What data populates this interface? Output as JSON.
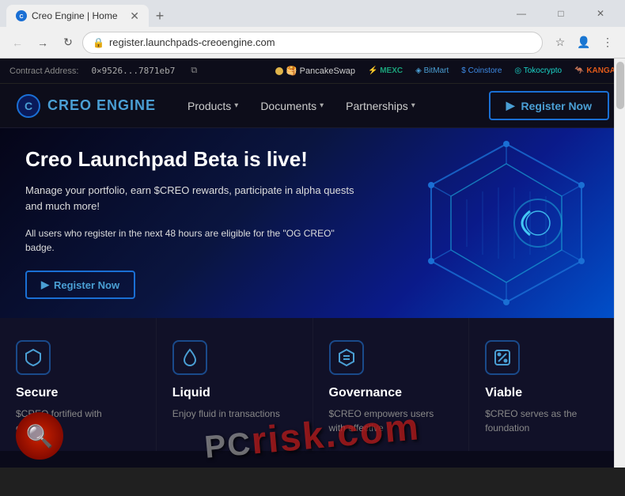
{
  "browser": {
    "tab": {
      "title": "Creo Engine | Home",
      "favicon": "C"
    },
    "address": "register.launchpads-creoengine.com",
    "window_controls": {
      "minimize": "—",
      "maximize": "□",
      "close": "✕"
    }
  },
  "bookmarks": [
    {
      "id": "pancakeswap",
      "label": "PancakeSwap",
      "color": "#e0b44a"
    },
    {
      "id": "mexc",
      "label": "MEXC",
      "color": "#1ba27a"
    },
    {
      "id": "bitmart",
      "label": "BitMart",
      "color": "#1a6fd4"
    },
    {
      "id": "coinstore",
      "label": "Coinstore",
      "color": "#3e8be6"
    },
    {
      "id": "tokocrypto",
      "label": "Tokocrypto",
      "color": "#1ad4c8"
    },
    {
      "id": "kanga",
      "label": "KANGA",
      "color": "#e05a1a"
    }
  ],
  "topbar": {
    "contract_label": "Contract Address:",
    "contract_address": "0×9526...7871eb7",
    "partners": [
      {
        "id": "pancakeswap",
        "label": "PancakeSwap",
        "color": "#e0b44a"
      },
      {
        "id": "mexc",
        "label": "MEXC",
        "color": "#1ba27a"
      },
      {
        "id": "bitmart",
        "label": "BitMart",
        "color": "#1a6fd4"
      },
      {
        "id": "coinstore",
        "label": "Coinstore",
        "color": "#3e8be6"
      },
      {
        "id": "tokocrypto",
        "label": "Tokocrypto",
        "color": "#1ad4c8"
      },
      {
        "id": "kanga",
        "label": "KANGA",
        "color": "#e05a1a"
      }
    ]
  },
  "navbar": {
    "logo_text": "CREO ENGINE",
    "nav_items": [
      {
        "id": "products",
        "label": "Products",
        "has_dropdown": true
      },
      {
        "id": "documents",
        "label": "Documents",
        "has_dropdown": true
      },
      {
        "id": "partnerships",
        "label": "Partnerships",
        "has_dropdown": true
      }
    ],
    "register_btn": "Register Now"
  },
  "hero": {
    "title": "Creo Launchpad Beta is live!",
    "subtitle": "Manage your portfolio, earn $CREO rewards, participate in alpha quests and much more!",
    "badge_text": "All users who register in the next 48 hours are eligible for the \"OG CREO\" badge.",
    "register_btn": "Register Now"
  },
  "features": [
    {
      "id": "secure",
      "icon": "shield",
      "title": "Secure",
      "desc": "$CREO fortified with certificates"
    },
    {
      "id": "liquid",
      "icon": "droplet",
      "title": "Liquid",
      "desc": "Enjoy fluid in transactions"
    },
    {
      "id": "governance",
      "icon": "hexagon",
      "title": "Governance",
      "desc": "$CREO empowers users with effective"
    },
    {
      "id": "viable",
      "icon": "percent",
      "title": "Viable",
      "desc": "$CREO serves as the foundation"
    }
  ],
  "watermark": {
    "text": "risk.com"
  }
}
